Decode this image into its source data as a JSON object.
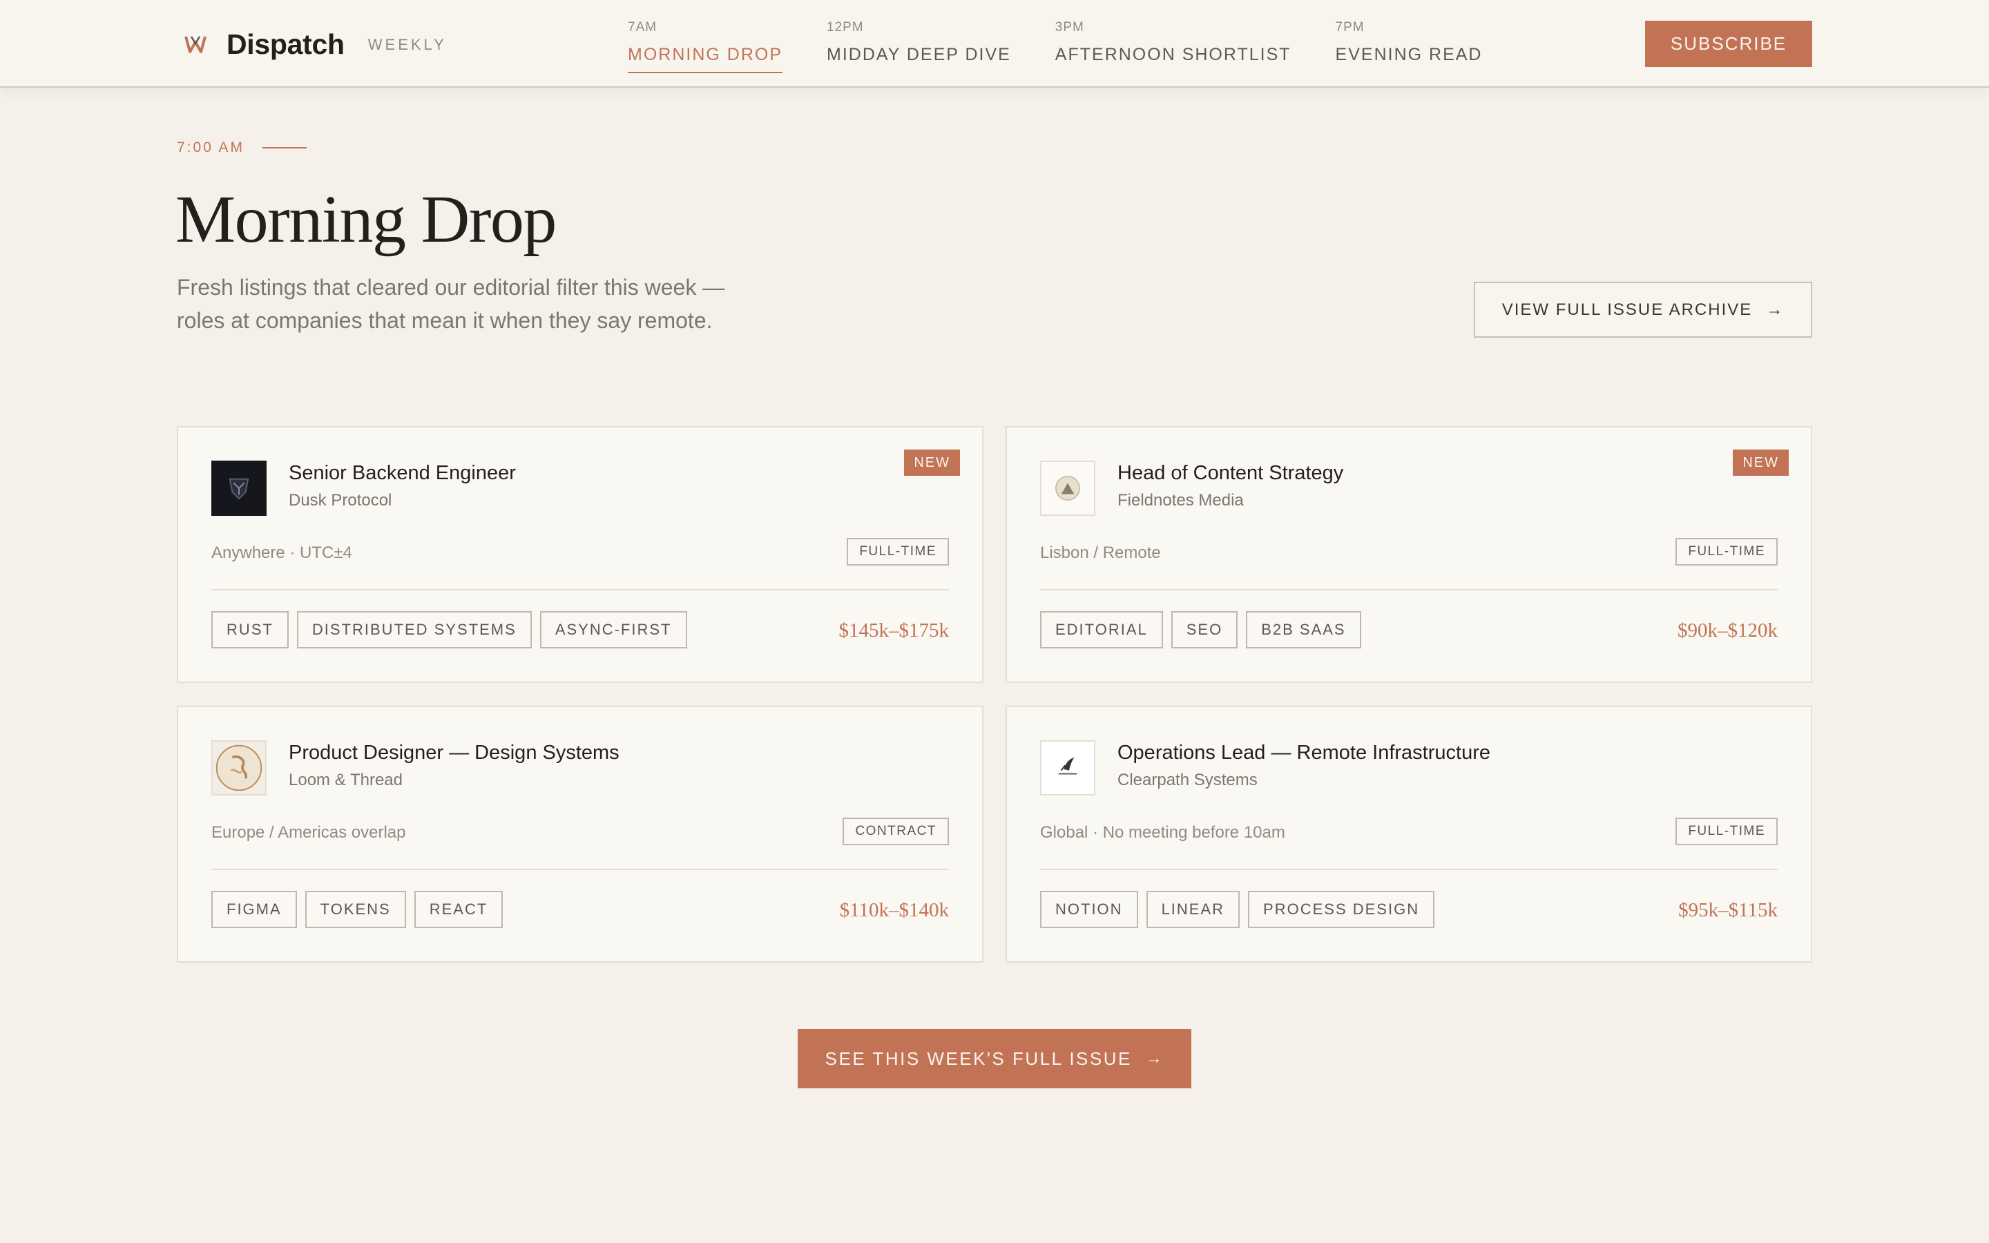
{
  "header": {
    "brand_name": "Dispatch",
    "brand_sub": "WEEKLY",
    "nav": [
      {
        "time": "7AM",
        "label": "MORNING DROP",
        "active": true
      },
      {
        "time": "12PM",
        "label": "MIDDAY DEEP DIVE",
        "active": false
      },
      {
        "time": "3PM",
        "label": "AFTERNOON SHORTLIST",
        "active": false
      },
      {
        "time": "7PM",
        "label": "EVENING READ",
        "active": false
      }
    ],
    "subscribe_label": "SUBSCRIBE"
  },
  "hero": {
    "eyebrow": "7:00 AM",
    "title": "Morning Drop",
    "intro_line1": "Fresh listings that cleared our editorial filter this week —",
    "intro_line2": "roles at companies that mean it when they say remote.",
    "archive_label": "VIEW FULL ISSUE ARCHIVE",
    "arrow": "→"
  },
  "jobs": [
    {
      "title": "Senior Backend Engineer",
      "company": "Dusk Protocol",
      "badge": "NEW",
      "location": "Anywhere · UTC±4",
      "type": "FULL-TIME",
      "tags": [
        "RUST",
        "DISTRIBUTED SYSTEMS",
        "ASYNC-FIRST"
      ],
      "salary": "$145k–$175k"
    },
    {
      "title": "Head of Content Strategy",
      "company": "Fieldnotes Media",
      "badge": "NEW",
      "location": "Lisbon / Remote",
      "type": "FULL-TIME",
      "tags": [
        "EDITORIAL",
        "SEO",
        "B2B SAAS"
      ],
      "salary": "$90k–$120k"
    },
    {
      "title": "Product Designer — Design Systems",
      "company": "Loom & Thread",
      "location": "Europe / Americas overlap",
      "type": "CONTRACT",
      "tags": [
        "FIGMA",
        "TOKENS",
        "REACT"
      ],
      "salary": "$110k–$140k"
    },
    {
      "title": "Operations Lead — Remote Infrastructure",
      "company": "Clearpath Systems",
      "location": "Global · No meeting before 10am",
      "type": "FULL-TIME",
      "tags": [
        "NOTION",
        "LINEAR",
        "PROCESS DESIGN"
      ],
      "salary": "$95k–$115k"
    }
  ],
  "cta_label": "SEE THIS WEEK'S FULL ISSUE",
  "colors": {
    "accent": "#c27356",
    "background": "#f5f1ea",
    "card": "#faf8f3",
    "text": "#231f1c",
    "muted": "#8f8a83"
  }
}
